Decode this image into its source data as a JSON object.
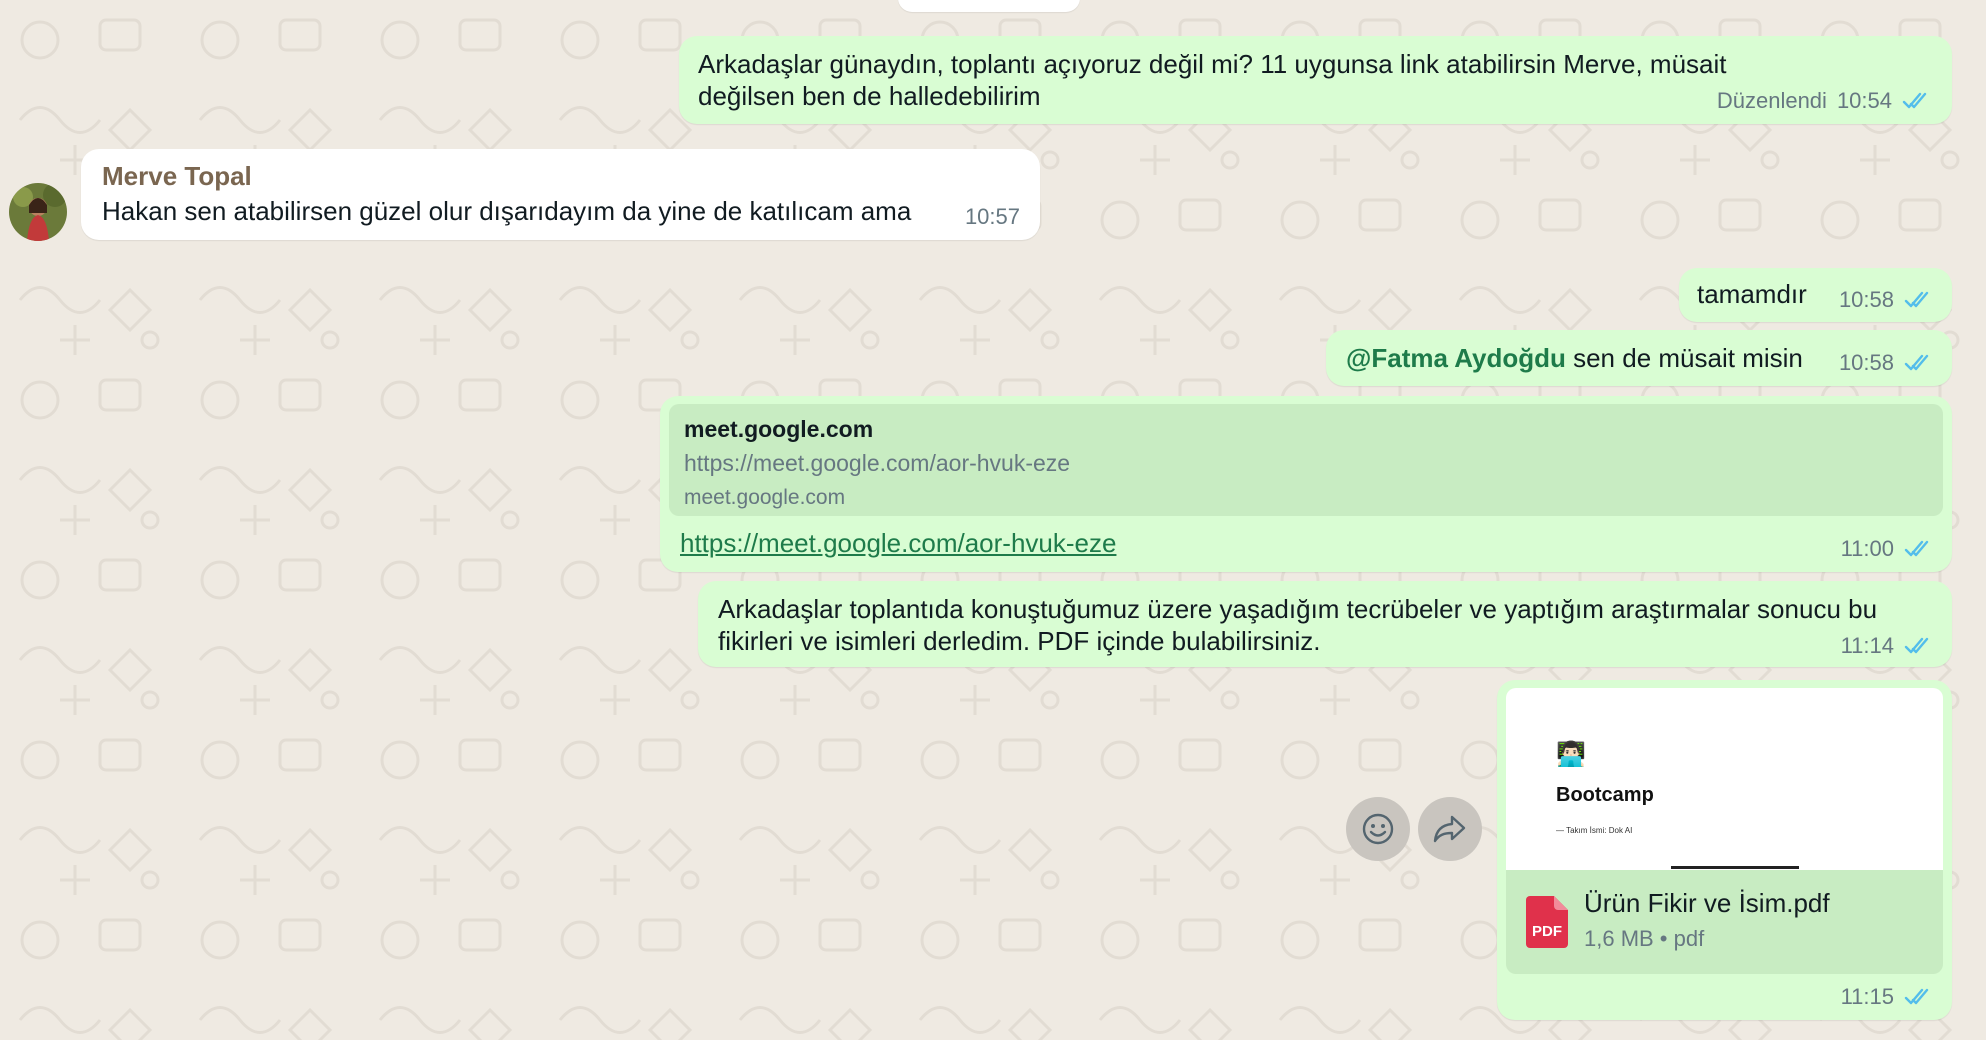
{
  "theme": {
    "outgoing_bg": "#d9fdd3",
    "incoming_bg": "#ffffff",
    "tick_color": "#53bdeb",
    "link_color": "#1e7b4a",
    "sender_color": "#7a6650",
    "pdf_icon_color": "#e0314b"
  },
  "messages": {
    "m1": {
      "text": "Arkadaşlar günaydın, toplantı açıyoruz değil mi? 11 uygunsa link atabilirsin Merve, müsait değilsen ben de halledebilirim",
      "edited_label": "Düzenlendi",
      "time": "10:54"
    },
    "m2": {
      "sender": "Merve Topal",
      "text": "Hakan sen atabilirsen güzel olur dışarıdayım da yine de katılıcam ama",
      "time": "10:57"
    },
    "m3": {
      "text": "tamamdır",
      "time": "10:58"
    },
    "m4": {
      "mention": "@Fatma Aydoğdu",
      "text": " sen de müsait misin",
      "time": "10:58"
    },
    "m5": {
      "preview_title": "meet.google.com",
      "preview_url": "https://meet.google.com/aor-hvuk-eze",
      "preview_domain": "meet.google.com",
      "link": "https://meet.google.com/aor-hvuk-eze",
      "time": "11:00"
    },
    "m6": {
      "text": "Arkadaşlar toplantıda konuştuğumuz üzere yaşadığım tecrübeler ve yaptığım araştırmalar sonucu bu fikirleri ve isimleri derledim. PDF içinde bulabilirsiniz.",
      "time": "11:14"
    },
    "m7": {
      "doc_title": "Bootcamp",
      "doc_subtitle": "— Takım İsmi: Dok AI",
      "file_name": "Ürün Fikir ve İsim.pdf",
      "file_meta": "1,6 MB • pdf",
      "file_icon_label": "PDF",
      "time": "11:15"
    }
  },
  "actions": {
    "react_icon": "emoji-icon",
    "forward_icon": "forward-icon"
  }
}
